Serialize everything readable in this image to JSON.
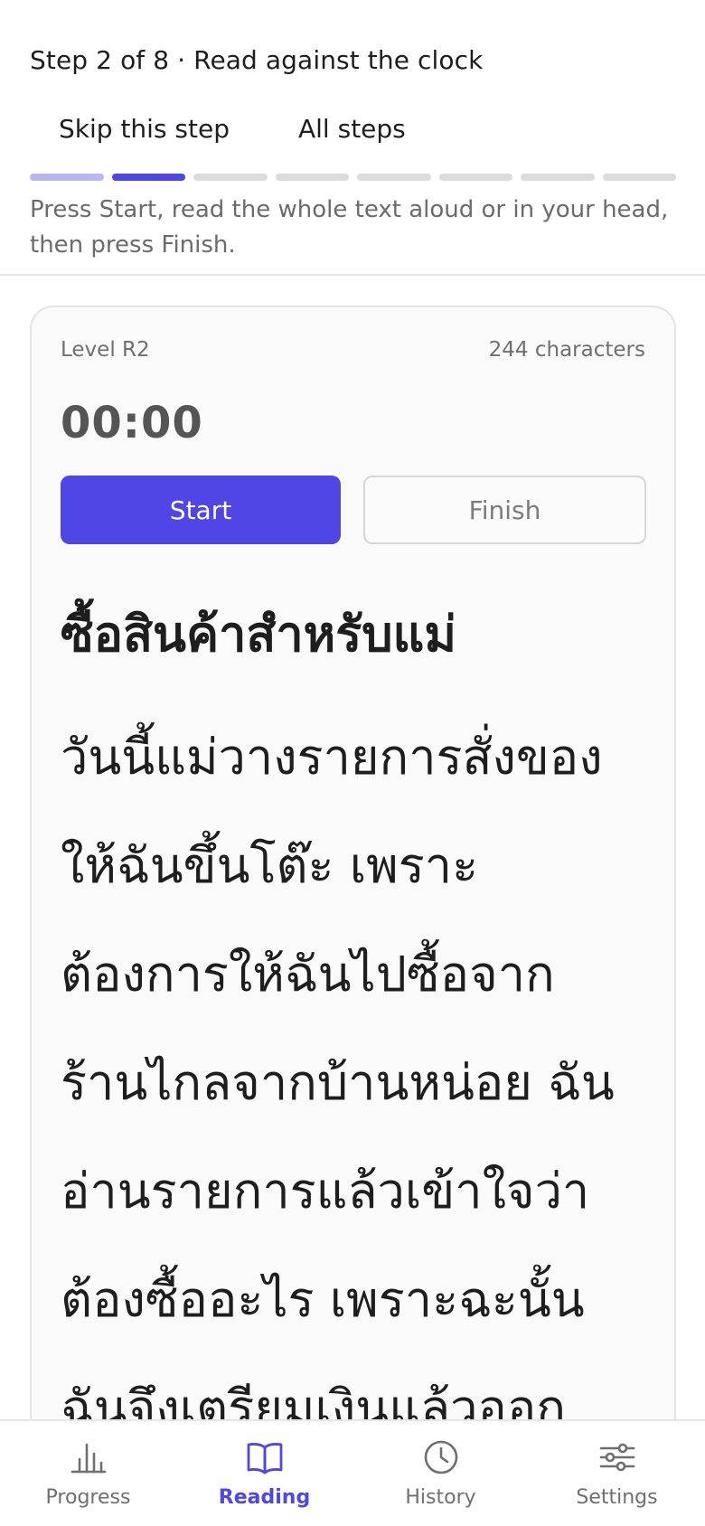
{
  "header": {
    "step_title": "Step 2 of 8 · Read against the clock",
    "skip_label": "Skip this step",
    "all_steps_label": "All steps",
    "progress": {
      "total_steps": 8,
      "current_step": 2
    },
    "instruction": "Press Start, read the whole text aloud or in your head, then press Finish."
  },
  "card": {
    "level": "Level R2",
    "char_count": "244 characters",
    "timer": "00:00",
    "start_label": "Start",
    "finish_label": "Finish",
    "story_title": "ซื้อสินค้าสำหรับแม่",
    "story_lines": [
      "วันนี้แม่วางรายการสั่งของ",
      "ให้ฉันขึ้นโต๊ะ เพราะ",
      "ต้องการให้ฉันไปซื้อจาก",
      "ร้านไกลจากบ้านหน่อย ฉัน",
      "อ่านรายการแล้วเข้าใจว่า",
      "ต้องซื้ออะไร เพราะฉะนั้น",
      "ฉันจึงเตรียมเงินแล้วออก"
    ]
  },
  "nav": {
    "items": [
      {
        "label": "Progress",
        "icon": "bar-chart-icon",
        "active": false
      },
      {
        "label": "Reading",
        "icon": "open-book-icon",
        "active": true
      },
      {
        "label": "History",
        "icon": "clock-icon",
        "active": false
      },
      {
        "label": "Settings",
        "icon": "sliders-icon",
        "active": false
      }
    ]
  },
  "colors": {
    "accent": "#4f46e5",
    "accent_light": "#b7b5f2",
    "inactive_segment": "#dcdcdc",
    "muted_text": "#6f6f6f"
  }
}
